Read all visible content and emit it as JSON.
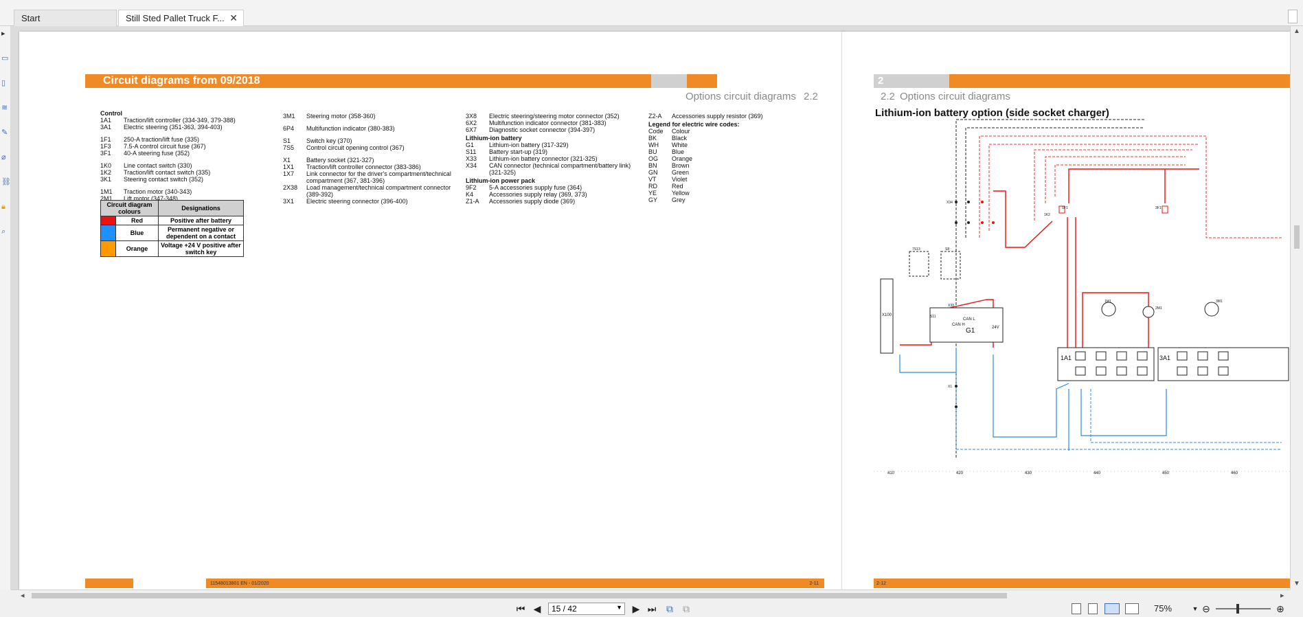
{
  "tabs": [
    {
      "label": "Start"
    },
    {
      "label": "Still Sted Pallet Truck F..."
    }
  ],
  "left_page": {
    "title": "Circuit diagrams from 09/2018",
    "chapter_num": "2",
    "section_title": "Options circuit diagrams",
    "section_num": "2.2",
    "col1": [
      {
        "heading": "Control"
      },
      {
        "code": "1A1",
        "desc": "Traction/lift controller (334-349, 379-388)"
      },
      {
        "code": "3A1",
        "desc": "Electric steering (351-363, 394-403)"
      },
      {
        "gap": true
      },
      {
        "code": "1F1",
        "desc": "250-A traction/lift fuse (335)"
      },
      {
        "code": "1F3",
        "desc": "7.5-A control circuit fuse (367)"
      },
      {
        "code": "3F1",
        "desc": "40-A steering fuse (352)"
      },
      {
        "gap": true
      },
      {
        "code": "1K0",
        "desc": "Line contact switch (330)"
      },
      {
        "code": "1K2",
        "desc": "Traction/lift contact switch (335)"
      },
      {
        "code": "3K1",
        "desc": "Steering contact switch (352)"
      },
      {
        "gap": true
      },
      {
        "code": "1M1",
        "desc": "Traction motor (340-343)"
      },
      {
        "code": "2M1",
        "desc": "Lift motor (347-348)"
      }
    ],
    "col2": [
      {
        "code": "3M1",
        "desc": "Steering motor (358-360)"
      },
      {
        "gap": true
      },
      {
        "code": "6P4",
        "desc": "Multifunction indicator (380-383)"
      },
      {
        "gap": true
      },
      {
        "code": "S1",
        "desc": "Switch key (370)"
      },
      {
        "code": "7S5",
        "desc": "Control circuit opening control (367)"
      },
      {
        "gap": true
      },
      {
        "code": "X1",
        "desc": "Battery socket (321-327)"
      },
      {
        "code": "1X1",
        "desc": "Traction/lift controller connector (383-386)"
      },
      {
        "code": "1X7",
        "desc": "Link connector for the driver's compartment/technical compartment (367, 381-396)"
      },
      {
        "code": "2X38",
        "desc": "Load management/technical compartment connector (389-392)"
      },
      {
        "code": "3X1",
        "desc": "Electric steering connector (396-400)"
      }
    ],
    "col3": [
      {
        "code": "3X8",
        "desc": "Electric steering/steering motor connector (352)"
      },
      {
        "code": "6X2",
        "desc": "Multifunction indicator connector (381-383)"
      },
      {
        "code": "6X7",
        "desc": "Diagnostic socket connector (394-397)"
      },
      {
        "heading": "Lithium-ion battery"
      },
      {
        "code": "G1",
        "desc": "Lithium-ion battery (317-329)"
      },
      {
        "code": "S11",
        "desc": "Battery start-up (319)"
      },
      {
        "code": "X33",
        "desc": "Lithium-ion battery connector (321-325)"
      },
      {
        "code": "X34",
        "desc": "CAN connector (technical compartment/battery link) (321-325)"
      },
      {
        "heading": "Lithium-ion power pack"
      },
      {
        "code": "9F2",
        "desc": "5-A accessories supply fuse (364)"
      },
      {
        "code": "K4",
        "desc": "Accessories supply relay (369, 373)"
      },
      {
        "code": "Z1-A",
        "desc": "Accessories supply diode (369)"
      }
    ],
    "col4": [
      {
        "code": "Z2-A",
        "desc": "Accessories supply resistor (369)"
      },
      {
        "heading": "Legend for electric wire codes:"
      },
      {
        "code": "Code",
        "desc": "Colour"
      },
      {
        "code": "BK",
        "desc": "Black"
      },
      {
        "code": "WH",
        "desc": "White"
      },
      {
        "code": "BU",
        "desc": "Blue"
      },
      {
        "code": "OG",
        "desc": "Orange"
      },
      {
        "code": "BN",
        "desc": "Brown"
      },
      {
        "code": "GN",
        "desc": "Green"
      },
      {
        "code": "VT",
        "desc": "Violet"
      },
      {
        "code": "RD",
        "desc": "Red"
      },
      {
        "code": "YE",
        "desc": "Yellow"
      },
      {
        "code": "GY",
        "desc": "Grey"
      }
    ],
    "colour_table": {
      "header_colour": "Circuit diagram colours",
      "header_designation": "Designations",
      "rows": [
        {
          "swatch": "#ee1111",
          "colour": "Red",
          "designation": "Positive after battery"
        },
        {
          "swatch": "#1e90ff",
          "colour": "Blue",
          "designation": "Permanent negative or dependent on a contact"
        },
        {
          "swatch": "#ff9900",
          "colour": "Orange",
          "designation": "Voltage +24 V positive after switch key"
        }
      ]
    },
    "footer_doc": "11548013801 EN - 01/2020",
    "footer_page": "2-11"
  },
  "right_page": {
    "chapter_num": "2",
    "section_num": "2.2",
    "section_title": "Options circuit diagrams",
    "diagram_title": "Lithium-ion battery option (side socket charger)",
    "footer_page": "2-12",
    "labels": {
      "g1": "G1",
      "can_h": "CAN H",
      "can_l": "CAN L",
      "c24v": "24V",
      "x100": "X100",
      "a1": "1A1",
      "a3": "3A1",
      "m1": "1M1",
      "m2": "2M1",
      "m3": "3M1",
      "s8": "S8",
      "s11": "S11",
      "s3": "7S13",
      "x33": "X33",
      "x34": "X34",
      "x1": "X1",
      "k2": "1K2",
      "f1": "1F1",
      "f3": "3F1",
      "ruler": [
        "410",
        "420",
        "430",
        "440",
        "450",
        "460"
      ]
    }
  },
  "toolbar": {
    "page_value": "15 / 42",
    "zoom": "75%"
  },
  "colors": {
    "accent_orange": "#f08a24",
    "wire_red": "#ee1111",
    "wire_blue": "#1e90ff"
  }
}
